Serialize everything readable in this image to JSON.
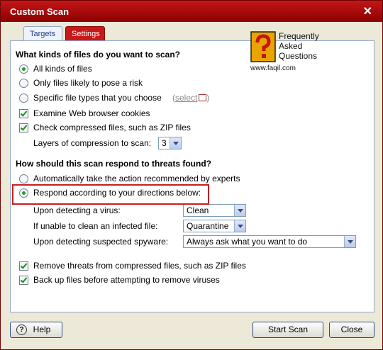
{
  "window": {
    "title": "Custom Scan"
  },
  "tabs": [
    {
      "label": "Targets"
    },
    {
      "label": "Settings"
    }
  ],
  "section1": {
    "heading": "What kinds of files do you want to scan?",
    "options": [
      {
        "label": "All kinds of files",
        "selected": true
      },
      {
        "label": "Only files likely to pose a risk",
        "selected": false
      },
      {
        "label": "Specific file types that you choose",
        "selected": false
      }
    ],
    "select_link": "select",
    "checks": [
      {
        "label": "Examine Web browser cookies",
        "checked": true
      },
      {
        "label": "Check compressed files, such as ZIP files",
        "checked": true
      }
    ],
    "layers_label": "Layers of compression to scan:",
    "layers_value": "3"
  },
  "section2": {
    "heading": "How should this scan respond to threats found?",
    "options": [
      {
        "label": "Automatically take the action recommended by experts",
        "selected": false
      },
      {
        "label": "Respond according to your directions below:",
        "selected": true
      }
    ],
    "virus_label": "Upon detecting a virus:",
    "virus_value": "Clean",
    "infected_label": "If unable to clean an infected file:",
    "infected_value": "Quarantine",
    "spyware_label": "Upon detecting suspected spyware:",
    "spyware_value": "Always ask what you want to do",
    "checks": [
      {
        "label": "Remove threats from compressed files, such as ZIP files",
        "checked": true
      },
      {
        "label": "Back up files before attempting to remove viruses",
        "checked": true
      }
    ]
  },
  "watermark": {
    "line1": "Frequently",
    "line2": "Asked",
    "line3": "Questions",
    "url": "www.faqil.com"
  },
  "buttons": {
    "help": "Help",
    "start": "Start Scan",
    "close": "Close"
  },
  "colors": {
    "accent": "#c41616",
    "panel_border": "#8fa7c9"
  }
}
